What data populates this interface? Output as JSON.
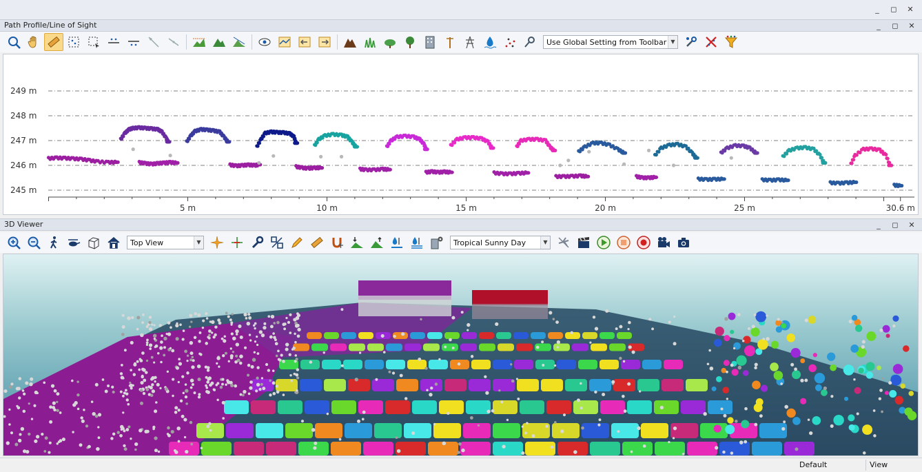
{
  "top_window": {
    "restore_icon": "restore",
    "close_icon": "close"
  },
  "profile_panel": {
    "title": "Path Profile/Line of Sight",
    "toolbar": {
      "mode_select": "Use Global Setting from Toolbar"
    }
  },
  "chart_data": {
    "type": "scatter",
    "title": "",
    "xlabel": "",
    "ylabel": "",
    "x_ticks": [
      "5 m",
      "10 m",
      "15 m",
      "20 m",
      "25 m",
      "30.6 m"
    ],
    "x_tick_values": [
      5,
      10,
      15,
      20,
      25,
      30.6
    ],
    "y_ticks": [
      "245 m",
      "246 m",
      "247 m",
      "248 m",
      "249 m"
    ],
    "y_tick_values": [
      245,
      246,
      247,
      248,
      249
    ],
    "xlim": [
      0,
      30.6
    ],
    "ylim": [
      244.8,
      250.2
    ],
    "grid": "horizontal dash-dot",
    "series": [
      {
        "color": "#9b1fa0",
        "points": [
          [
            0.0,
            246.28
          ],
          [
            0.4,
            246.3
          ],
          [
            0.8,
            246.29
          ],
          [
            1.2,
            246.27
          ],
          [
            1.6,
            246.25
          ],
          [
            2.0,
            246.2
          ],
          [
            2.4,
            246.15
          ],
          [
            2.9,
            246.12
          ],
          [
            3.3,
            246.13
          ]
        ]
      },
      {
        "color": "#6a2aa0",
        "points": [
          [
            3.5,
            247.05
          ],
          [
            3.7,
            247.3
          ],
          [
            3.9,
            247.45
          ],
          [
            4.1,
            247.5
          ],
          [
            4.4,
            247.52
          ],
          [
            4.7,
            247.5
          ],
          [
            5.0,
            247.48
          ],
          [
            5.3,
            247.45
          ],
          [
            5.5,
            247.35
          ],
          [
            5.7,
            247.1
          ],
          [
            5.8,
            246.95
          ]
        ]
      },
      {
        "color": "#a020a8",
        "points": [
          [
            4.4,
            246.12
          ],
          [
            4.7,
            246.08
          ],
          [
            5.0,
            246.05
          ],
          [
            5.3,
            246.08
          ],
          [
            5.6,
            246.1
          ],
          [
            5.9,
            246.12
          ],
          [
            6.2,
            246.1
          ]
        ]
      },
      {
        "color": "#3b3b9e",
        "points": [
          [
            6.7,
            246.95
          ],
          [
            6.9,
            247.2
          ],
          [
            7.1,
            247.38
          ],
          [
            7.4,
            247.45
          ],
          [
            7.7,
            247.43
          ],
          [
            8.0,
            247.4
          ],
          [
            8.3,
            247.35
          ],
          [
            8.5,
            247.15
          ],
          [
            8.7,
            246.95
          ]
        ]
      },
      {
        "color": "#9b1fa0",
        "points": [
          [
            8.8,
            246.02
          ],
          [
            9.1,
            245.98
          ],
          [
            9.4,
            246.0
          ],
          [
            9.7,
            246.02
          ],
          [
            10.0,
            246.0
          ],
          [
            10.2,
            246.03
          ]
        ]
      },
      {
        "color": "#0e1a8a",
        "points": [
          [
            10.1,
            246.75
          ],
          [
            10.3,
            247.05
          ],
          [
            10.5,
            247.3
          ],
          [
            10.8,
            247.35
          ],
          [
            11.1,
            247.33
          ],
          [
            11.4,
            247.32
          ],
          [
            11.7,
            247.28
          ],
          [
            11.9,
            247.15
          ],
          [
            12.0,
            246.9
          ]
        ]
      },
      {
        "color": "#9b1fa0",
        "points": [
          [
            12.0,
            245.95
          ],
          [
            12.3,
            245.9
          ],
          [
            12.6,
            245.88
          ],
          [
            12.9,
            245.9
          ],
          [
            13.2,
            245.9
          ]
        ]
      },
      {
        "color": "#17a3a0",
        "points": [
          [
            12.9,
            246.8
          ],
          [
            13.1,
            247.05
          ],
          [
            13.4,
            247.2
          ],
          [
            13.8,
            247.25
          ],
          [
            14.2,
            247.22
          ],
          [
            14.5,
            247.15
          ],
          [
            14.7,
            246.95
          ],
          [
            14.9,
            246.75
          ]
        ]
      },
      {
        "color": "#a020a8",
        "points": [
          [
            15.1,
            245.85
          ],
          [
            15.4,
            245.82
          ],
          [
            15.8,
            245.82
          ],
          [
            16.2,
            245.85
          ],
          [
            16.5,
            245.83
          ]
        ]
      },
      {
        "color": "#c82ad8",
        "points": [
          [
            16.4,
            246.75
          ],
          [
            16.6,
            247.0
          ],
          [
            16.9,
            247.15
          ],
          [
            17.3,
            247.18
          ],
          [
            17.7,
            247.15
          ],
          [
            18.0,
            247.05
          ],
          [
            18.2,
            246.85
          ],
          [
            18.3,
            246.65
          ]
        ]
      },
      {
        "color": "#a020a8",
        "points": [
          [
            18.3,
            245.72
          ],
          [
            18.6,
            245.75
          ],
          [
            18.9,
            245.72
          ],
          [
            19.2,
            245.74
          ],
          [
            19.5,
            245.72
          ]
        ]
      },
      {
        "color": "#e82ac8",
        "points": [
          [
            19.5,
            246.8
          ],
          [
            19.8,
            247.05
          ],
          [
            20.2,
            247.12
          ],
          [
            20.6,
            247.12
          ],
          [
            21.0,
            247.08
          ],
          [
            21.3,
            246.95
          ],
          [
            21.5,
            246.7
          ]
        ]
      },
      {
        "color": "#a020a8",
        "points": [
          [
            21.6,
            245.7
          ],
          [
            22.0,
            245.66
          ],
          [
            22.4,
            245.66
          ],
          [
            22.8,
            245.68
          ],
          [
            23.2,
            245.7
          ]
        ]
      },
      {
        "color": "#e82ab8",
        "points": [
          [
            22.7,
            246.75
          ],
          [
            22.9,
            247.0
          ],
          [
            23.3,
            247.05
          ],
          [
            23.7,
            247.05
          ],
          [
            24.1,
            247.0
          ],
          [
            24.3,
            246.75
          ],
          [
            24.5,
            246.6
          ]
        ]
      },
      {
        "color": "#9b1fa0",
        "points": [
          [
            24.6,
            245.55
          ],
          [
            25.0,
            245.55
          ],
          [
            25.4,
            245.56
          ],
          [
            25.8,
            245.58
          ],
          [
            26.1,
            245.55
          ]
        ]
      },
      {
        "color": "#2a5a9e",
        "points": [
          [
            25.7,
            246.55
          ],
          [
            26.0,
            246.75
          ],
          [
            26.4,
            246.9
          ],
          [
            26.8,
            246.9
          ],
          [
            27.2,
            246.82
          ],
          [
            27.6,
            246.65
          ],
          [
            27.9,
            246.5
          ]
        ]
      },
      {
        "color": "#a020a8",
        "points": [
          [
            28.5,
            245.55
          ],
          [
            28.8,
            245.5
          ],
          [
            29.1,
            245.5
          ],
          [
            29.4,
            245.52
          ]
        ]
      },
      {
        "color": "#1d6a96",
        "points": [
          [
            29.4,
            246.4
          ],
          [
            29.7,
            246.7
          ],
          [
            30.1,
            246.82
          ],
          [
            30.5,
            246.85
          ],
          [
            30.9,
            246.75
          ],
          [
            31.2,
            246.5
          ],
          [
            31.4,
            246.3
          ]
        ]
      },
      {
        "color": "#2a5a9e",
        "points": [
          [
            31.5,
            245.45
          ],
          [
            31.9,
            245.43
          ],
          [
            32.3,
            245.44
          ],
          [
            32.7,
            245.45
          ]
        ]
      },
      {
        "color": "#6a3aa6",
        "points": [
          [
            32.6,
            246.5
          ],
          [
            32.9,
            246.7
          ],
          [
            33.3,
            246.8
          ],
          [
            33.7,
            246.78
          ],
          [
            34.0,
            246.7
          ],
          [
            34.3,
            246.5
          ]
        ]
      },
      {
        "color": "#2a5a9e",
        "points": [
          [
            34.6,
            245.42
          ],
          [
            35.0,
            245.4
          ],
          [
            35.4,
            245.42
          ],
          [
            35.8,
            245.4
          ]
        ]
      },
      {
        "color": "#23a0a0",
        "points": [
          [
            35.6,
            246.35
          ],
          [
            35.9,
            246.6
          ],
          [
            36.3,
            246.7
          ],
          [
            36.7,
            246.72
          ],
          [
            37.1,
            246.65
          ],
          [
            37.4,
            246.4
          ],
          [
            37.6,
            246.1
          ]
        ]
      },
      {
        "color": "#2a5a9e",
        "points": [
          [
            37.9,
            245.3
          ],
          [
            38.3,
            245.28
          ],
          [
            38.7,
            245.3
          ],
          [
            39.1,
            245.32
          ]
        ]
      },
      {
        "color": "#e82a9e",
        "points": [
          [
            38.9,
            246.05
          ],
          [
            39.1,
            246.4
          ],
          [
            39.5,
            246.65
          ],
          [
            39.9,
            246.67
          ],
          [
            40.3,
            246.62
          ],
          [
            40.6,
            246.4
          ],
          [
            40.8,
            246.0
          ]
        ]
      },
      {
        "color": "#2a5a9e",
        "points": [
          [
            41.0,
            245.2
          ],
          [
            41.3,
            245.18
          ]
        ]
      }
    ],
    "gray_points": [
      [
        4.1,
        246.65
      ],
      [
        5.9,
        246.4
      ],
      [
        10.2,
        246.1
      ],
      [
        10.9,
        246.38
      ],
      [
        13.2,
        246.35
      ],
      [
        14.2,
        246.35
      ],
      [
        24.8,
        246.0
      ],
      [
        25.2,
        246.2
      ],
      [
        26.2,
        246.55
      ],
      [
        27.9,
        246.05
      ],
      [
        29.1,
        246.6
      ],
      [
        30.3,
        246.0
      ],
      [
        33.1,
        246.3
      ]
    ]
  },
  "viewer_panel": {
    "title": "3D Viewer",
    "view_select": "Top View",
    "environment_select": "Tropical Sunny Day"
  },
  "status": {
    "left": "Default",
    "right": "View"
  }
}
